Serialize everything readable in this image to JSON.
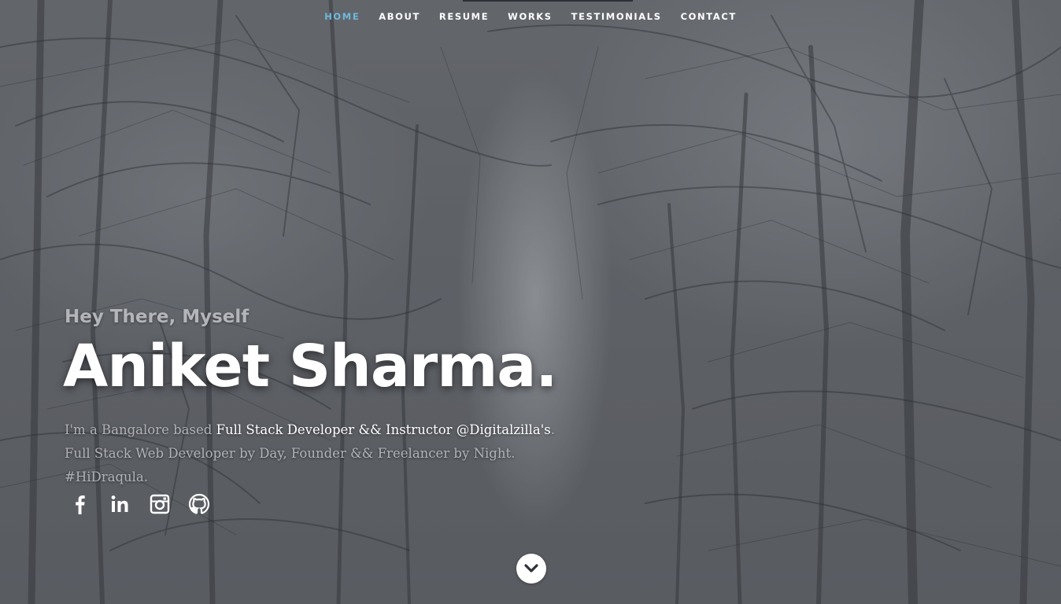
{
  "nav": {
    "items": [
      {
        "label": "HOME",
        "active": true
      },
      {
        "label": "ABOUT",
        "active": false
      },
      {
        "label": "RESUME",
        "active": false
      },
      {
        "label": "WORKS",
        "active": false
      },
      {
        "label": "TESTIMONIALS",
        "active": false
      },
      {
        "label": "CONTACT",
        "active": false
      }
    ],
    "active_color": "#6fb8db"
  },
  "banner": {
    "greeting": "Hey There, Myself",
    "name": "Aniket Sharma.",
    "intro_prefix": "I'm a Bangalore based ",
    "intro_highlight": "Full Stack Developer && Instructor @Digitalzilla's",
    "intro_suffix": ". Full Stack Web Developer by Day, Founder && Freelancer by Night. #HiDraqula."
  },
  "social": [
    {
      "icon": "facebook-icon"
    },
    {
      "icon": "linkedin-icon"
    },
    {
      "icon": "instagram-icon"
    },
    {
      "icon": "github-icon"
    }
  ],
  "scroll_icon": "chevron-down-icon"
}
